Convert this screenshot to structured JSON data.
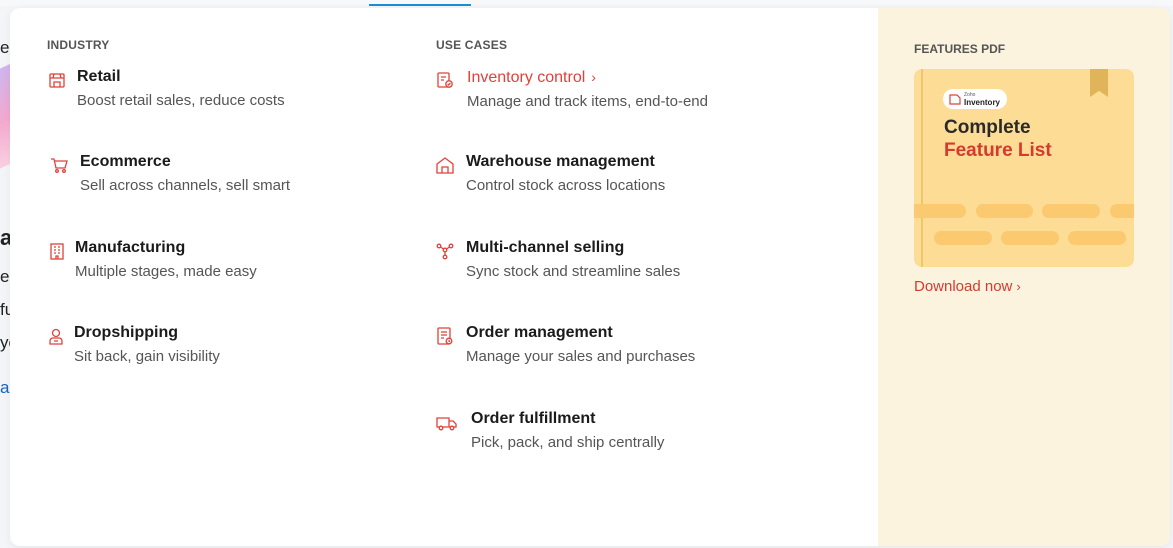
{
  "background": {
    "chars": [
      "er",
      "al",
      "e",
      "fu",
      "yo",
      "a"
    ]
  },
  "industry": {
    "title": "INDUSTRY",
    "items": [
      {
        "title": "Retail",
        "desc": "Boost retail sales, reduce costs",
        "icon": "store-icon"
      },
      {
        "title": "Ecommerce",
        "desc": "Sell across channels, sell smart",
        "icon": "cart-icon"
      },
      {
        "title": "Manufacturing",
        "desc": "Multiple stages, made easy",
        "icon": "factory-icon"
      },
      {
        "title": "Dropshipping",
        "desc": "Sit back, gain visibility",
        "icon": "person-badge-icon"
      }
    ]
  },
  "use_cases": {
    "title": "USE CASES",
    "items": [
      {
        "title": "Inventory control",
        "chevron": "›",
        "desc": "Manage and track items, end-to-end",
        "icon": "inventory-check-icon",
        "active": true
      },
      {
        "title": "Warehouse management",
        "desc": "Control stock across locations",
        "icon": "warehouse-icon"
      },
      {
        "title": "Multi-channel selling",
        "desc": "Sync stock and streamline sales",
        "icon": "network-icon"
      },
      {
        "title": "Order management",
        "desc": "Manage your sales and purchases",
        "icon": "order-document-icon"
      },
      {
        "title": "Order fulfillment",
        "desc": "Pick, pack, and ship centrally",
        "icon": "delivery-truck-icon"
      }
    ]
  },
  "features_pdf": {
    "title": "FEATURES PDF",
    "book": {
      "brand_small": "Zoho",
      "brand_name": "Inventory",
      "line1": "Complete",
      "line2": "Feature List"
    },
    "download_label": "Download now",
    "download_chevron": "›"
  },
  "colors": {
    "accent_red": "#e0413a",
    "promo_bg": "#fcf3df",
    "book_bg": "#fddc95",
    "top_nav_accent": "#1a8fd6"
  }
}
